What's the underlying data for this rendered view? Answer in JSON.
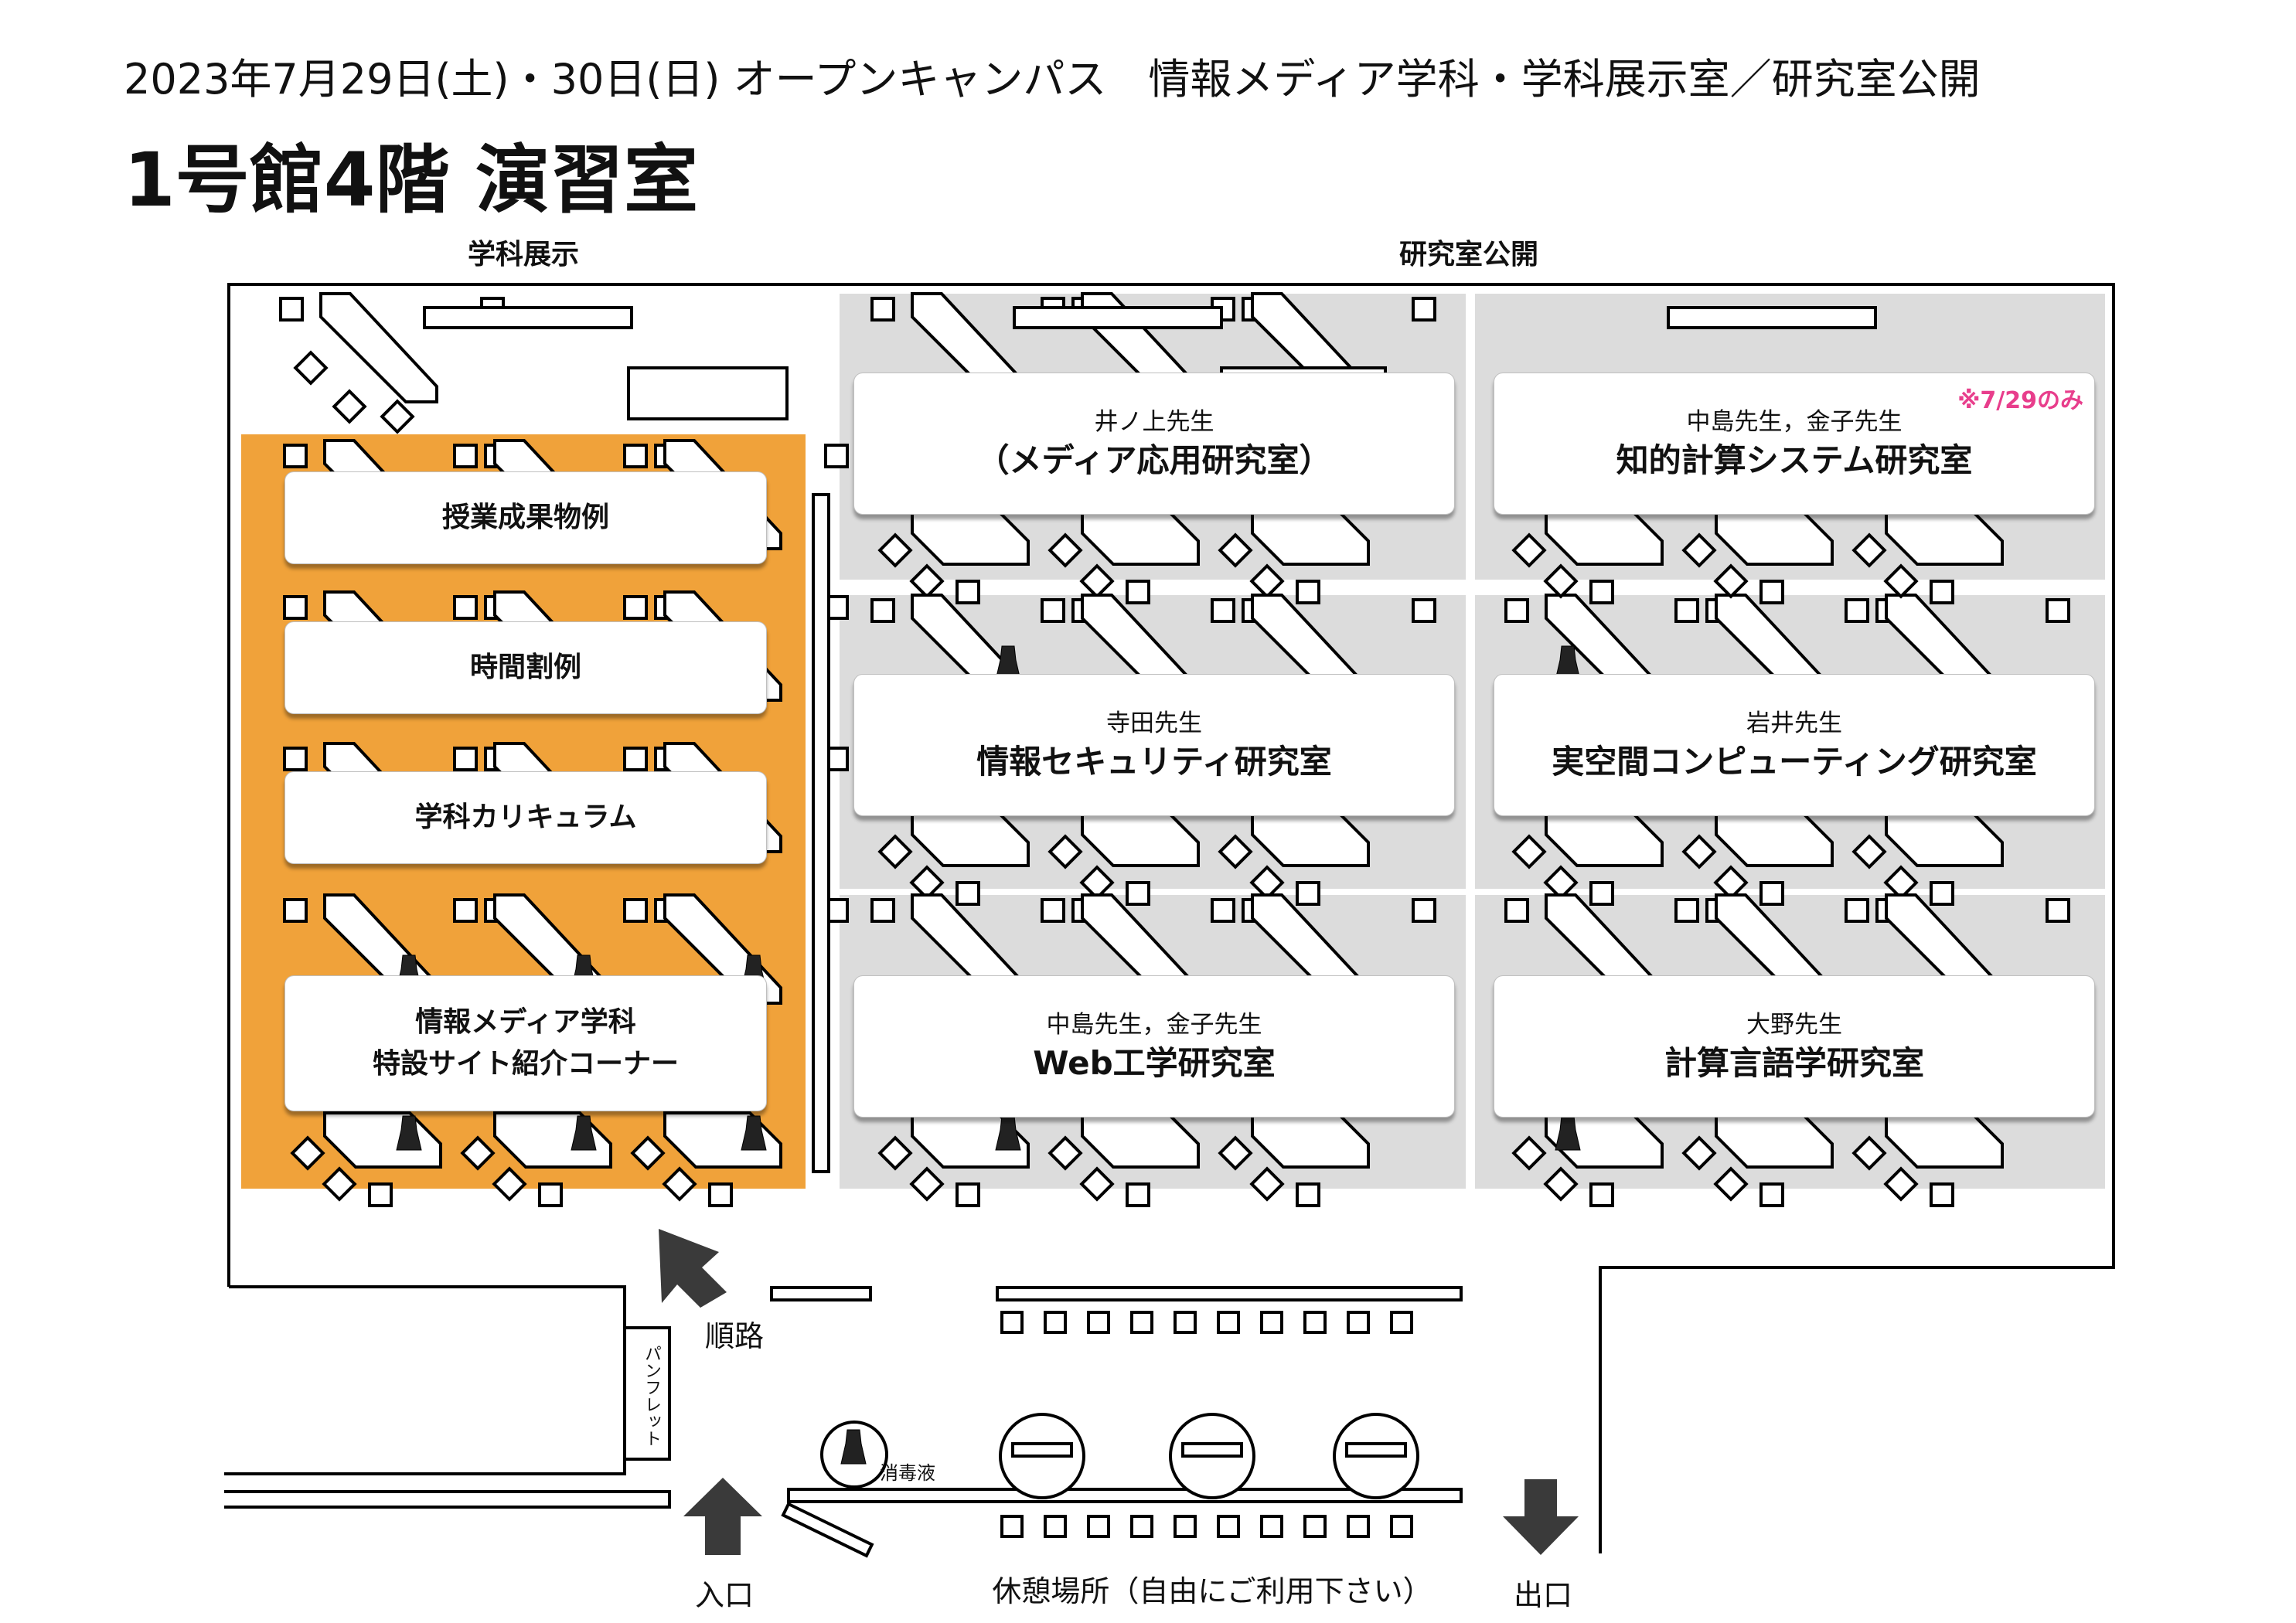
{
  "header": {
    "event_line": "2023年7月29日(土)・30日(日)  オープンキャンパス　情報メディア学科・学科展示室／研究室公開",
    "room_title": "1号館4階 演習室"
  },
  "sections": {
    "exhibit_label": "学科展示",
    "labs_label": "研究室公開"
  },
  "exhibits": [
    {
      "label": "授業成果物例"
    },
    {
      "label": "時間割例"
    },
    {
      "label": "学科カリキュラム"
    },
    {
      "line1": "情報メディア学科",
      "line2": "特設サイト紹介コーナー"
    }
  ],
  "labs": [
    {
      "teacher": "井ノ上先生",
      "name": "（メディア応用研究室）"
    },
    {
      "teacher": "中島先生，金子先生",
      "name": "知的計算システム研究室",
      "note": "※7/29のみ"
    },
    {
      "teacher": "寺田先生",
      "name": "情報セキュリティ研究室"
    },
    {
      "teacher": "岩井先生",
      "name": "実空間コンピューティング研究室"
    },
    {
      "teacher": "中島先生，金子先生",
      "name": "Web工学研究室"
    },
    {
      "teacher": "大野先生",
      "name": "計算言語学研究室"
    }
  ],
  "labels": {
    "route": "順路",
    "pamphlet": "パンフレット",
    "disinfectant": "消毒液",
    "entrance": "入口",
    "exit": "出口",
    "rest_area": "休憩場所（自由にご利用下さい）"
  },
  "colors": {
    "exhibit_area": "#f0a23a",
    "lab_area": "#dcdcdc",
    "accent_note": "#e83e8c"
  }
}
